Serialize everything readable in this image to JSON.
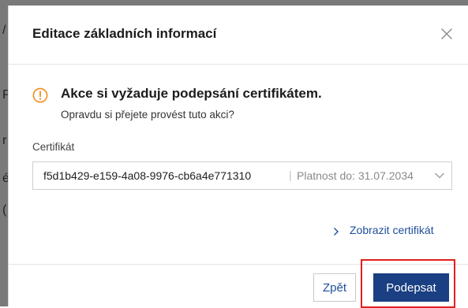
{
  "background": {
    "glyphs": [
      "/",
      "P",
      "r",
      "é",
      "("
    ]
  },
  "dialog": {
    "title": "Editace základních informací",
    "close_icon": "close-icon"
  },
  "warning": {
    "icon": "exclamation-circle-icon",
    "color": "#f28c1c",
    "title": "Akce si vyžaduje podepsání certifikátem.",
    "subtitle": "Opravdu si přejete provést tuto akci?"
  },
  "certificate": {
    "label": "Certifikát",
    "selected_id": "f5d1b429-e159-4a08-9976-cb6a4e771310",
    "separator": "|",
    "validity": "Platnost do: 31.07.2034",
    "chevron_icon": "chevron-down-icon"
  },
  "show_certificate": {
    "icon": "chevron-right-icon",
    "label": "Zobrazit certifikát"
  },
  "footer": {
    "back_label": "Zpět",
    "sign_label": "Podepsat",
    "primary_color": "#1a3f82",
    "highlight_color": "#e41e1e"
  }
}
